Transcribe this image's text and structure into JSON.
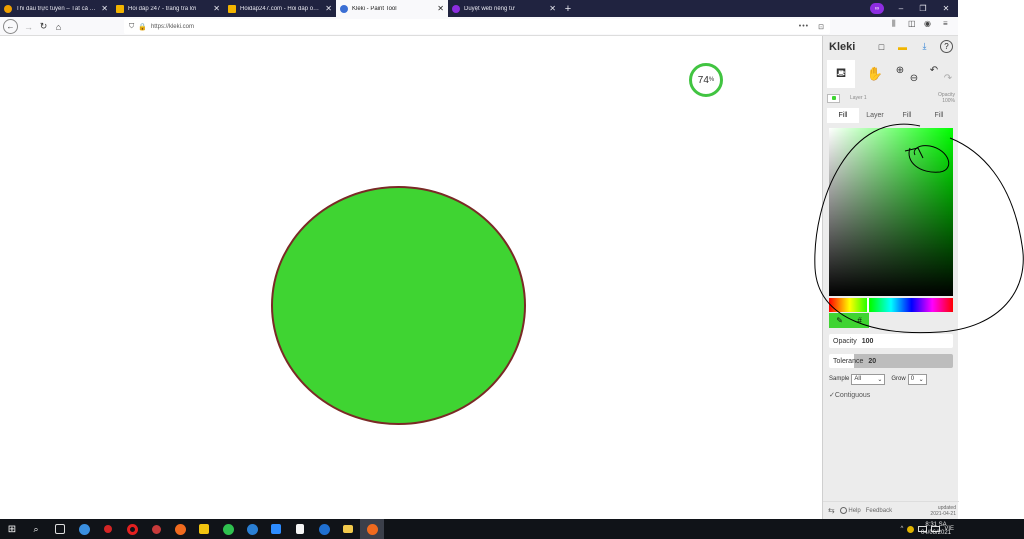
{
  "colors": {
    "accent_green": "#3fd432",
    "circle_stroke": "#7a2a26",
    "tabbar_bg": "#202340",
    "taskbar_bg": "#101318",
    "annotation": "#000000"
  },
  "browser": {
    "tabs": [
      {
        "title": "Thi đấu trực tuyến – Tất cả các",
        "icon": "coin-icon",
        "color": "#f0a000",
        "active": false
      },
      {
        "title": "Hỏi đáp 247 - trang tra lời",
        "icon": "h-logo-icon",
        "color": "#f2b400",
        "active": false
      },
      {
        "title": "Hoidap247.com - Hỏi đáp online",
        "icon": "h-logo-icon",
        "color": "#f2b400",
        "active": false
      },
      {
        "title": "Kleki - Paint Tool",
        "icon": "kleki-icon",
        "color": "#3b6fd4",
        "active": true
      },
      {
        "title": "Duyệt web riêng tư",
        "icon": "private-mask-icon",
        "color": "#8d2de0",
        "active": false
      }
    ],
    "close_glyph": "✕",
    "new_tab_glyph": "+",
    "url": "https://kleki.com",
    "url_menu": "•••",
    "window_controls": {
      "mask": "∞",
      "minimize": "–",
      "restore": "❐",
      "close": "✕"
    },
    "nav": {
      "back": "←",
      "forward": "→",
      "reload": "↻",
      "home": "⌂"
    },
    "toolbar_icons": {
      "library": "⫼",
      "sidebar": "◫",
      "account": "◉",
      "menu": "≡",
      "shield": "⛉",
      "lock": "🔒",
      "pocket": "⊡"
    }
  },
  "canvas": {
    "zoom_value": "74",
    "zoom_unit": "%"
  },
  "sidebar": {
    "logo": "Kleki",
    "top_icons": {
      "new": "□",
      "open": "▬",
      "save": "⤓",
      "help": "?"
    },
    "tools": {
      "fill": "⛾",
      "hand": "✋",
      "zoom_in": "⊕",
      "zoom_out": "⊖",
      "undo": "↶",
      "redo": "↷"
    },
    "layer": {
      "name": "Layer 1",
      "opacity_label": "Opacity",
      "opacity_value": "100%"
    },
    "modes": [
      "Fill",
      "Layer",
      "Fill",
      "Fill"
    ],
    "eyedropper": "✎",
    "hex": "#",
    "opacity": {
      "label": "Opacity",
      "value": "100"
    },
    "tolerance": {
      "label": "Tolerance",
      "value": "20",
      "fraction": 0.2
    },
    "sample": {
      "label": "Sample",
      "value": "All",
      "arrow": "⌄"
    },
    "grow": {
      "label": "Grow",
      "value": "0",
      "arrow": "⌄"
    },
    "contiguous": {
      "check": "✓",
      "label": "Contiguous"
    },
    "footer": {
      "swap": "⇆",
      "help": "Help",
      "feedback": "Feedback",
      "updated_label": "updated",
      "updated_date": "2021-04-21"
    }
  },
  "taskbar": {
    "start": "⊞",
    "search": "⌕",
    "items": [
      "task-view-icon",
      "edge-icon",
      "record-icon",
      "opera-icon",
      "game-icon",
      "firefox-icon",
      "notes-icon",
      "spotify-icon",
      "zalo-icon",
      "zoom-icon",
      "document-icon",
      "zalo-icon",
      "folder-icon",
      "firefox-active-icon"
    ],
    "tray": {
      "chevron": "^",
      "lang": "VIE"
    },
    "clock": {
      "time": "8:31 SA",
      "date": "04/06/2021"
    }
  }
}
